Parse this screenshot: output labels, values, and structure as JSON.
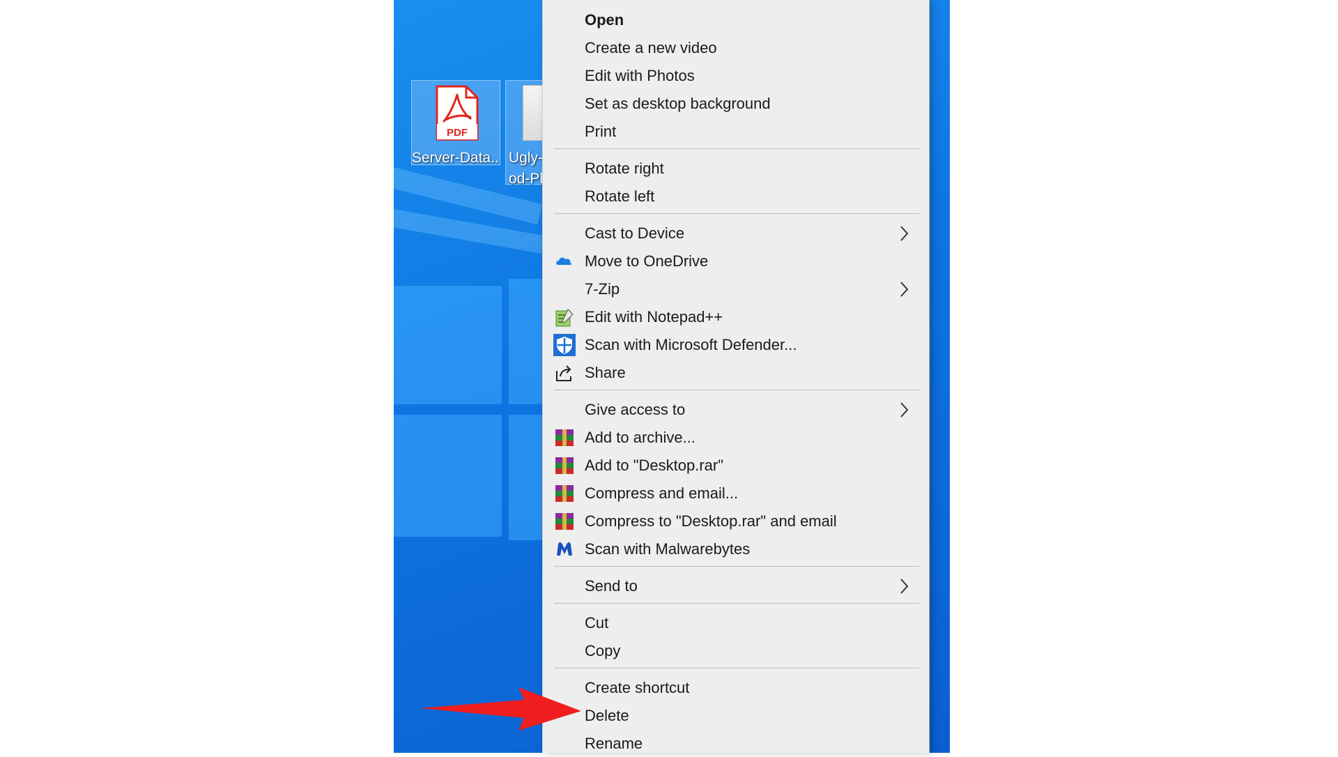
{
  "desktop": {
    "icons": [
      {
        "label": "Server-Data...",
        "icon": "pdf-file-icon",
        "badge": "PDF"
      },
      {
        "label": "Ugly-\nod-Ph",
        "icon": "image-file-icon"
      }
    ]
  },
  "menu": {
    "open": "Open",
    "create_video": "Create a new video",
    "edit_photos": "Edit with Photos",
    "set_background": "Set as desktop background",
    "print": "Print",
    "rotate_right": "Rotate right",
    "rotate_left": "Rotate left",
    "cast": "Cast to Device",
    "onedrive": "Move to OneDrive",
    "zip": "7-Zip",
    "notepad": "Edit with Notepad++",
    "defender": "Scan with Microsoft Defender...",
    "share": "Share",
    "give_access": "Give access to",
    "add_archive": "Add to archive...",
    "add_rar": "Add to \"Desktop.rar\"",
    "compress_email": "Compress and email...",
    "compress_rar_email": "Compress to \"Desktop.rar\" and email",
    "malwarebytes": "Scan with Malwarebytes",
    "send_to": "Send to",
    "cut": "Cut",
    "copy": "Copy",
    "create_shortcut": "Create shortcut",
    "delete": "Delete",
    "rename": "Rename"
  },
  "colors": {
    "desktop_blue": "#0e74e0",
    "menu_bg": "#eeeeee",
    "annotation_arrow": "#f01e1e",
    "pdf_red": "#e0261f"
  }
}
